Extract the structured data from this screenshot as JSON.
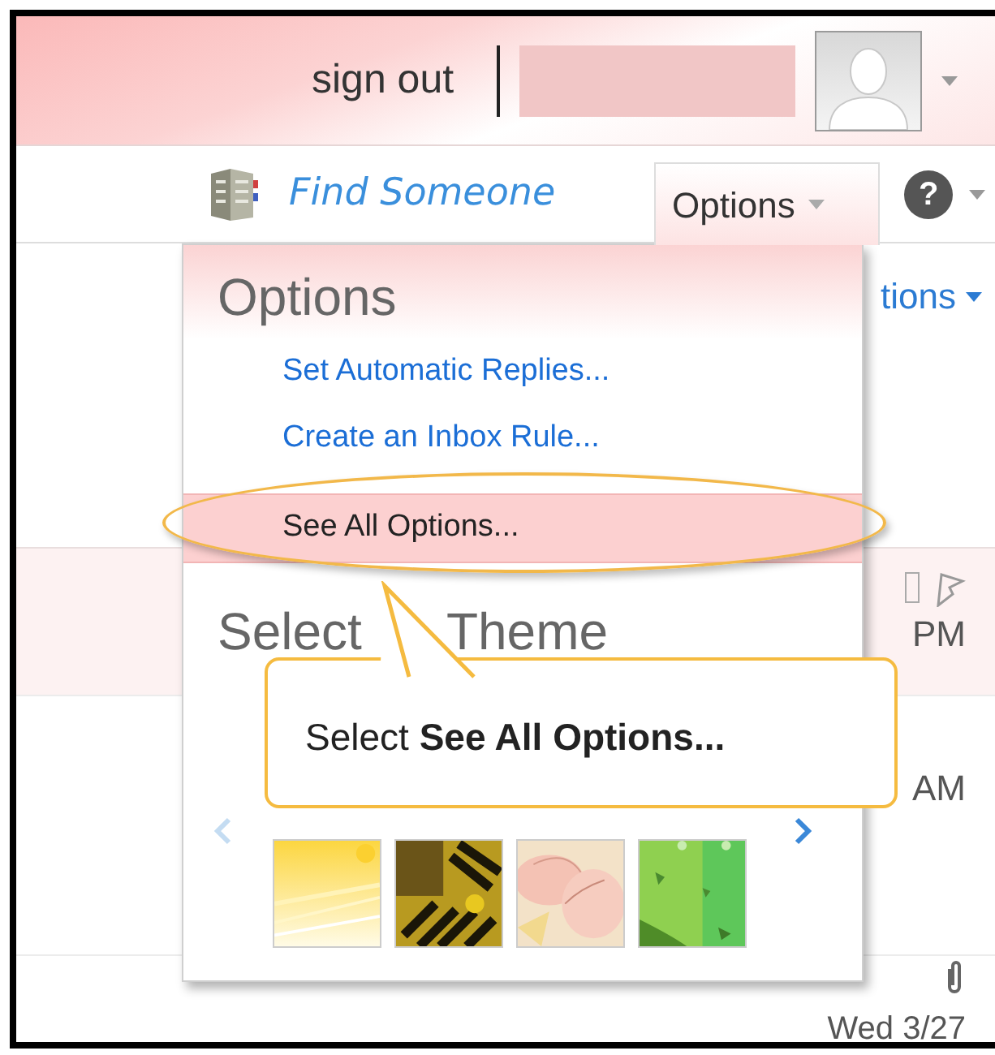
{
  "header": {
    "sign_out": "sign out"
  },
  "toolbar": {
    "find_someone": "Find Someone",
    "options_tab": {
      "label": "Options",
      "selected": true
    },
    "help": "?"
  },
  "message_list": {
    "filter_label": "tions",
    "rows": [
      {
        "time": "PM",
        "kind": "flagged"
      },
      {
        "time": "AM",
        "kind": "plain"
      },
      {
        "time": "Wed 3/27",
        "kind": "attachment"
      }
    ]
  },
  "options_menu": {
    "title": "Options",
    "items": [
      {
        "label": "Set Automatic Replies...",
        "selected": false
      },
      {
        "label": "Create an Inbox Rule...",
        "selected": false
      },
      {
        "label": "See All Options...",
        "selected": true
      }
    ],
    "theme_title": [
      "Select",
      "Theme"
    ],
    "themes": [
      {
        "kind": "picture"
      },
      {
        "kind": "picture"
      },
      {
        "kind": "picture"
      },
      {
        "kind": "picture"
      }
    ]
  },
  "callout": {
    "text": "Select **See All Options...**"
  }
}
